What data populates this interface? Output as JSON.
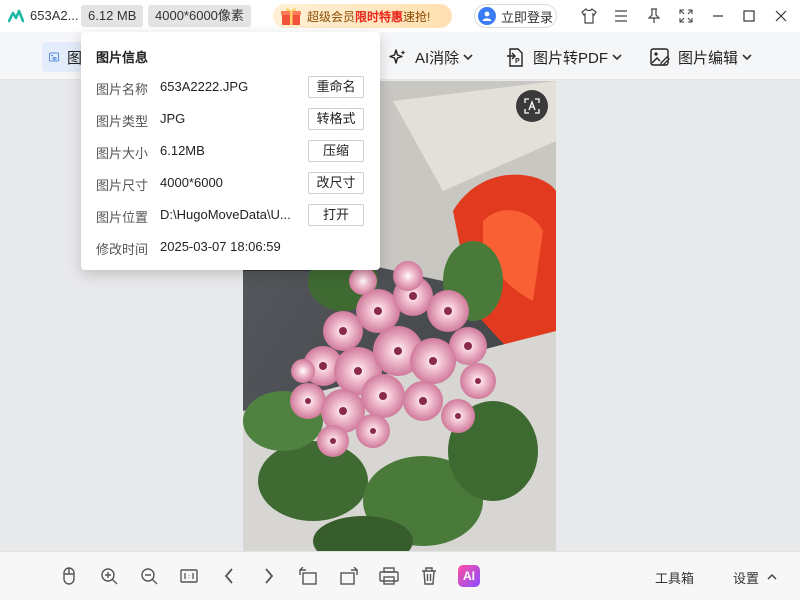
{
  "titlebar": {
    "file_name": "653A2...",
    "file_size_chip": "6.12 MB",
    "dimensions_chip": "4000*6000像素",
    "promo": {
      "part1": "超级会员",
      "highlight": "限时特惠",
      "part2": "速抢!"
    },
    "login_label": "立即登录"
  },
  "toolbar": {
    "active_tool_label": "图",
    "ai_erase": "AI消除",
    "to_pdf": "图片转PDF",
    "edit": "图片编辑"
  },
  "info_panel": {
    "title": "图片信息",
    "rows": [
      {
        "label": "图片名称",
        "value": "653A2222.JPG",
        "action": "重命名"
      },
      {
        "label": "图片类型",
        "value": "JPG",
        "action": "转格式"
      },
      {
        "label": "图片大小",
        "value": "6.12MB",
        "action": "压缩"
      },
      {
        "label": "图片尺寸",
        "value": "4000*6000",
        "action": "改尺寸"
      },
      {
        "label": "图片位置",
        "value": "D:\\HugoMoveData\\U...",
        "action": "打开"
      },
      {
        "label": "修改时间",
        "value": "2025-03-07 18:06:59"
      }
    ]
  },
  "bottombar": {
    "ai_label": "AI",
    "toolbox": "工具箱",
    "settings": "设置"
  },
  "icons": [
    "app-logo-icon",
    "gift-icon",
    "avatar-icon",
    "shirt-icon",
    "menu-icon",
    "pin-icon",
    "fullscreen-icon",
    "minimize-icon",
    "maximize-icon",
    "close-icon",
    "image-info-icon",
    "ai-erase-icon",
    "pdf-icon",
    "image-edit-icon",
    "chevron-down-icon",
    "ocr-text-icon",
    "mouse-icon",
    "zoom-in-icon",
    "zoom-out-icon",
    "actual-size-icon",
    "prev-icon",
    "next-icon",
    "rotate-left-icon",
    "rotate-right-icon",
    "print-icon",
    "delete-icon",
    "chevron-up-icon"
  ],
  "colors": {
    "accent": "#3a7bf6",
    "promo_highlight": "#e8281d",
    "active_tool_bg": "#e3ecfb"
  }
}
